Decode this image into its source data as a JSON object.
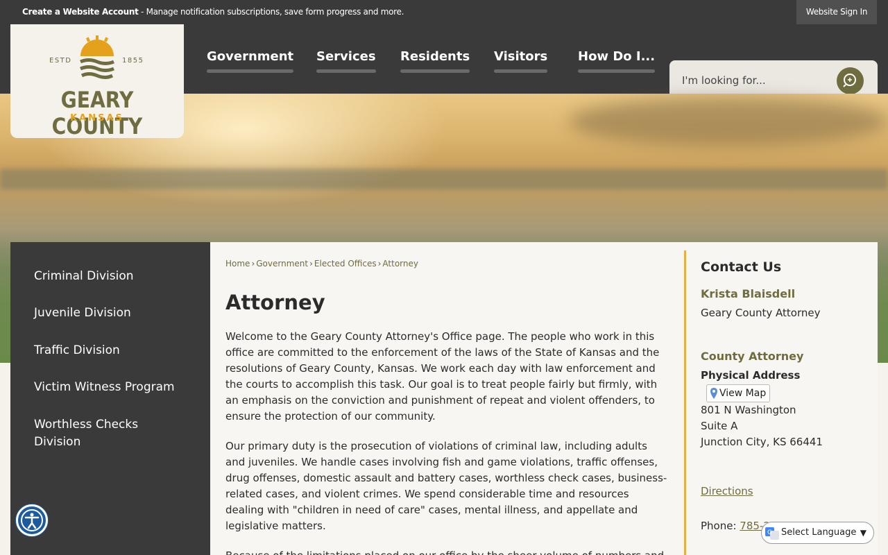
{
  "topbar": {
    "create_account": "Create a Website Account",
    "message": " - Manage notification subscriptions, save form progress and more.",
    "sign_in": "Website Sign In"
  },
  "logo": {
    "estd": "ESTD",
    "year": "1855",
    "name": "GEARY COUNTY",
    "state": "KANSAS"
  },
  "nav": [
    "Government",
    "Services",
    "Residents",
    "Visitors",
    "How Do I..."
  ],
  "search": {
    "placeholder": "I'm looking for..."
  },
  "sidebar": [
    "Criminal Division",
    "Juvenile Division",
    "Traffic Division",
    "Victim Witness Program",
    "Worthless Checks Division"
  ],
  "breadcrumb": [
    "Home",
    "Government",
    "Elected Offices",
    "Attorney"
  ],
  "page_title": "Attorney",
  "paragraphs": [
    "Welcome to the Geary County Attorney's Office page. The people who work in this office are committed to the enforcement of the laws of the State of Kansas and the resolutions of Geary County, Kansas. We work each day with law enforcement and the courts to accomplish this task. Our goal is to treat people fairly but firmly, with an emphasis on the conviction and punishment of repeat and violent offenders, to ensure the protection of our community.",
    "Our primary duty is the prosecution of violations of criminal law, including adults and juveniles. We handle cases involving fish and game violations, traffic offenses, drug offenses, domestic assault and battery cases, worthless check cases, business-related cases, and violent crimes. We spend considerable time and resources dealing with \"children in need of care\" cases, mental illness, and appellate and legislative matters.",
    "Because of the limitations placed on our office by the sheer volume of numbers and"
  ],
  "contact": {
    "heading": "Contact Us",
    "person": "Krista Blaisdell",
    "person_title": "Geary County Attorney",
    "office": "County Attorney",
    "address_label": "Physical Address",
    "view_map": "View Map",
    "address_line1": "801 N Washington",
    "address_line2": "Suite A",
    "address_line3": "Junction City, KS 66441",
    "directions": "Directions",
    "phone_label": "Phone: ",
    "phone": "785-2"
  },
  "language": {
    "label": "Select Language"
  },
  "colors": {
    "olive": "#6f6c3f",
    "gold": "#e4a21c",
    "dark": "#3a3a3a"
  }
}
